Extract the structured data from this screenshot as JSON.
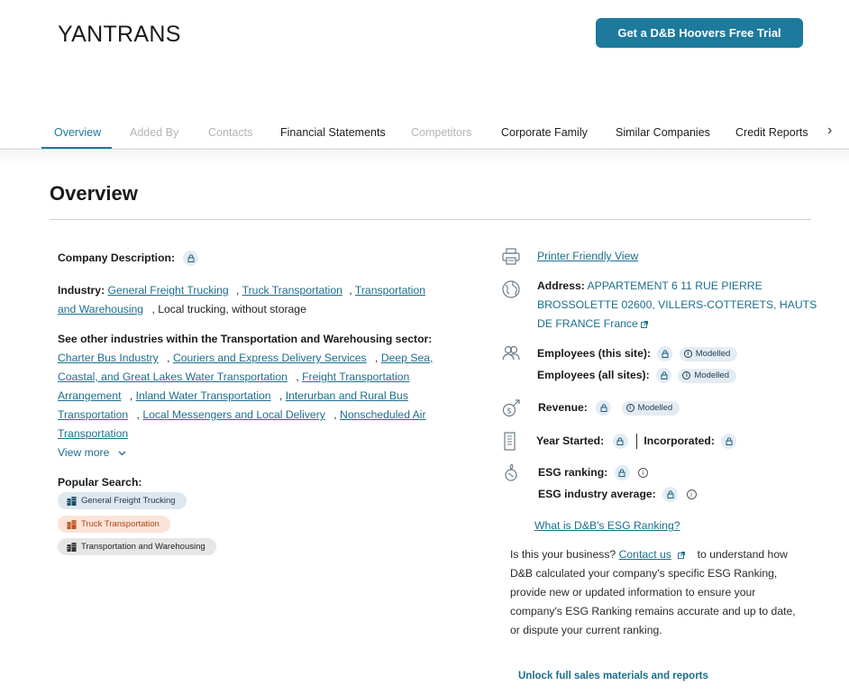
{
  "company": {
    "name": "YANTRANS"
  },
  "header": {
    "trial_button": "Get a D&B Hoovers Free Trial"
  },
  "tabs": [
    {
      "label": "Overview"
    },
    {
      "label": "Added By"
    },
    {
      "label": "Contacts"
    },
    {
      "label": "Financial Statements"
    },
    {
      "label": "Competitors"
    },
    {
      "label": "Corporate Family"
    },
    {
      "label": "Similar Companies"
    },
    {
      "label": "Credit Reports"
    }
  ],
  "overview": {
    "title": "Overview",
    "description_label": "Company Description:",
    "industry_label": "Industry:",
    "industry_links": [
      "General Freight Trucking",
      "Truck Transportation",
      "Transportation",
      "and Warehousing"
    ],
    "industry_text": ", Local trucking, without storage",
    "other_industries_label": "See other industries within the Transportation and Warehousing sector:",
    "other_industries": [
      "Charter Bus Industry",
      "Couriers and Express Delivery Services",
      "Deep Sea,",
      "Coastal, and Great Lakes Water Transportation",
      "Freight Transportation",
      "Arrangement",
      "Inland Water Transportation",
      "Interurban and Rural Bus",
      "Transportation",
      "Local Messengers and Local Delivery",
      "Nonscheduled Air",
      "Transportation"
    ],
    "view_more": "View more",
    "popular_search_label": "Popular Search:",
    "popular_searches": [
      "General Freight Trucking",
      "Truck Transportation",
      "Transportation and Warehousing"
    ]
  },
  "details": {
    "printer_link": "Printer Friendly View",
    "address_label": "Address:",
    "address_line1": "APPARTEMENT 6 11 RUE PIERRE",
    "address_line2": "BROSSOLETTE 02600, VILLERS-COTTERETS, HAUTS",
    "address_line3": "DE FRANCE France",
    "employees_site_label": "Employees (this site):",
    "employees_all_label": "Employees (all sites):",
    "modelled_badge": "Modelled",
    "revenue_label": "Revenue:",
    "year_started_label": "Year Started:",
    "incorporated_label": "Incorporated:",
    "esg_ranking_label": "ESG ranking:",
    "esg_industry_label": "ESG industry average:",
    "esg_link": "What is D&B's ESG Ranking?",
    "esg_para_prefix": "Is this your business?",
    "esg_para_link": "Contact us",
    "esg_para_line1_suffix": "to understand how",
    "esg_para_line2": "D&B calculated your company's specific ESG Ranking,",
    "esg_para_line3": "provide new or updated information to ensure your",
    "esg_para_line4": "company's ESG Ranking remains accurate and up to date,",
    "esg_para_line5": "or dispute your current ranking.",
    "unlock_text": "Unlock full sales materials and reports"
  },
  "colors": {
    "accent": "#1d7a9c",
    "link": "#1c6e8c",
    "lock_bg": "#e3ecf3",
    "pill_blue": "#dde7ef",
    "pill_orange": "#fbe3d8",
    "pill_gray": "#e6e6e6"
  },
  "icons": [
    "lock-icon",
    "printer-icon",
    "globe-icon",
    "people-icon",
    "revenue-icon",
    "building-icon",
    "esg-icon",
    "info-icon",
    "external-link-icon",
    "chevron-right-icon",
    "chevron-down-icon",
    "industry-building-icon"
  ]
}
